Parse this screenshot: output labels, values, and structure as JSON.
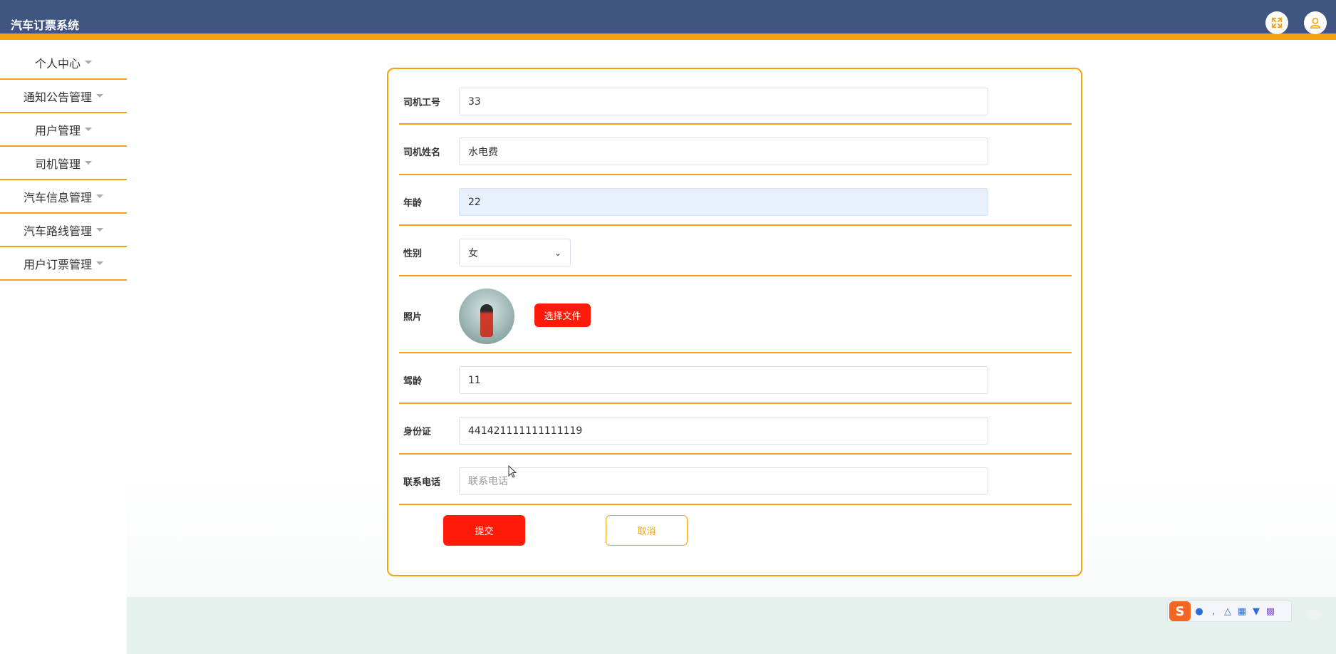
{
  "app": {
    "title": "汽车订票系统"
  },
  "header": {
    "fullscreen_icon": "expand-icon",
    "user_icon": "user-icon"
  },
  "sidebar": {
    "items": [
      {
        "label": "个人中心"
      },
      {
        "label": "通知公告管理"
      },
      {
        "label": "用户管理"
      },
      {
        "label": "司机管理"
      },
      {
        "label": "汽车信息管理"
      },
      {
        "label": "汽车路线管理"
      },
      {
        "label": "用户订票管理"
      }
    ]
  },
  "form": {
    "driver_id": {
      "label": "司机工号",
      "value": "33"
    },
    "driver_name": {
      "label": "司机姓名",
      "value": "水电费"
    },
    "age": {
      "label": "年龄",
      "value": "22"
    },
    "gender": {
      "label": "性别",
      "value": "女"
    },
    "photo": {
      "label": "照片",
      "choose_label": "选择文件"
    },
    "driving_years": {
      "label": "驾龄",
      "value": "11"
    },
    "id_card": {
      "label": "身份证",
      "value": "441421111111111119"
    },
    "phone": {
      "label": "联系电话",
      "placeholder": "联系电话"
    },
    "submit_label": "提交",
    "cancel_label": "取消"
  },
  "colors": {
    "header_bg": "#3f5680",
    "accent": "#f5a212",
    "primary_button": "#ff1a0a"
  },
  "ime_toolbar": {
    "logo": "S"
  }
}
